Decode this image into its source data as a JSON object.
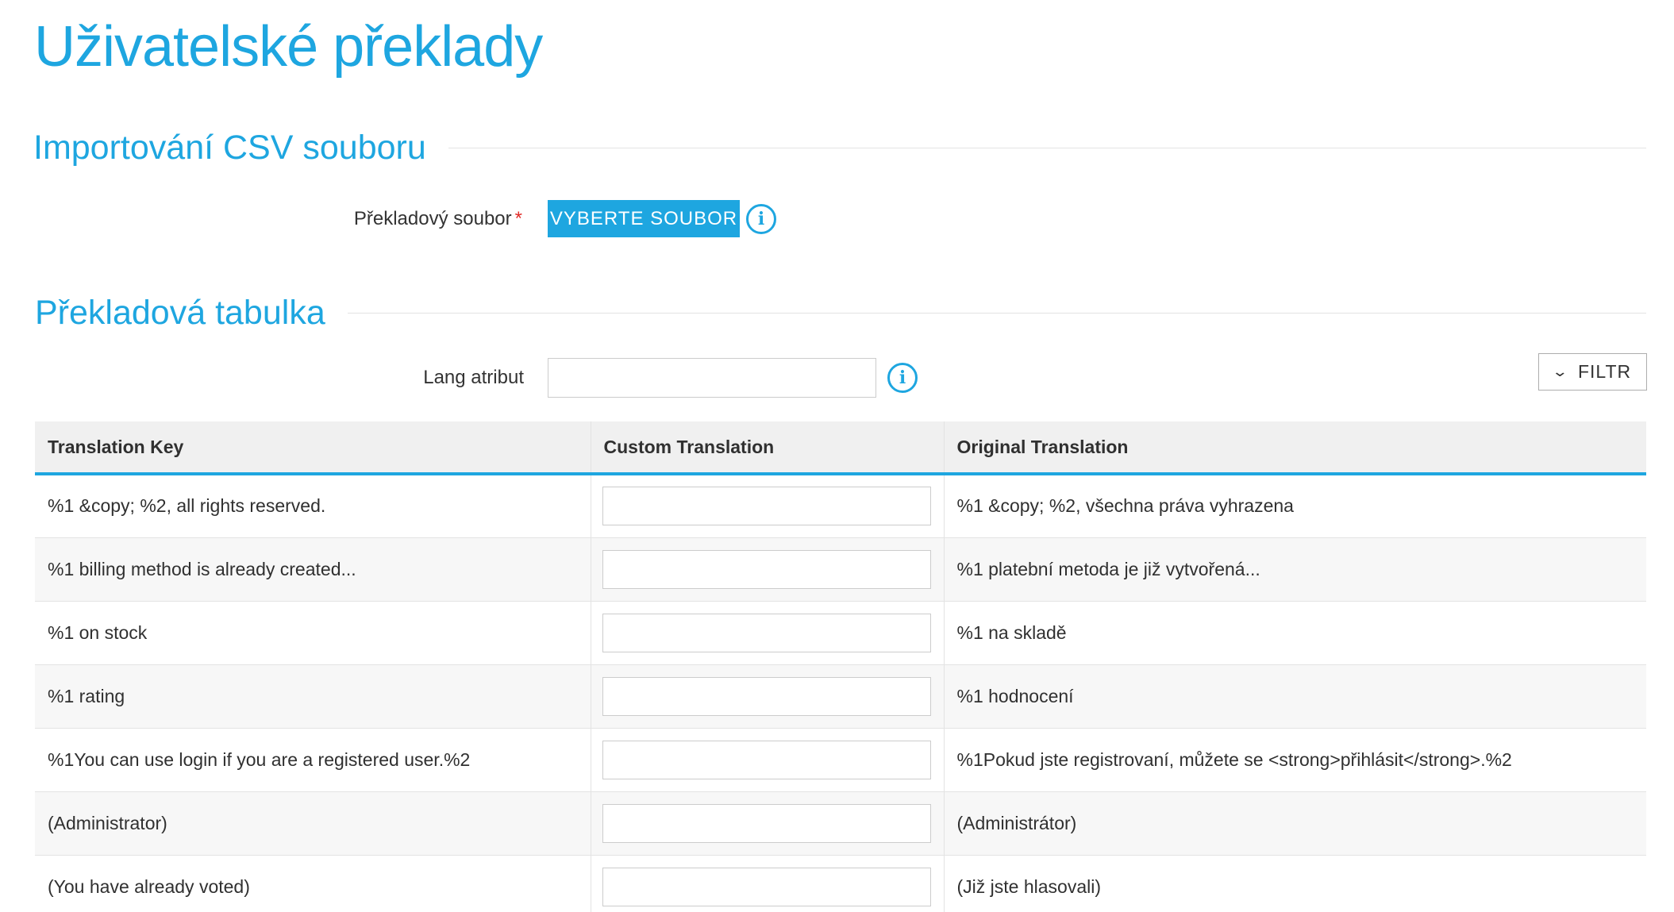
{
  "page": {
    "title": "Uživatelské překlady",
    "accent_color": "#1ea6e0"
  },
  "import_section": {
    "heading": "Importování CSV souboru",
    "file_label": "Překladový soubor",
    "required_mark": "*",
    "file_button": "VYBERTE SOUBOR",
    "info_icon": "i"
  },
  "table_section": {
    "heading": "Překladová tabulka",
    "lang_label": "Lang atribut",
    "lang_value": "",
    "info_icon": "i",
    "filter_label": "FILTR",
    "filter_icon": "⌄"
  },
  "table": {
    "columns": [
      "Translation Key",
      "Custom Translation",
      "Original Translation"
    ],
    "rows": [
      {
        "key": "%1 &copy; %2, all rights reserved.",
        "custom": "",
        "original": "%1 &copy; %2, všechna práva vyhrazena"
      },
      {
        "key": "%1 billing method is already created...",
        "custom": "",
        "original": "%1 platební metoda je již vytvořená..."
      },
      {
        "key": "%1 on stock",
        "custom": "",
        "original": "%1 na skladě"
      },
      {
        "key": "%1 rating",
        "custom": "",
        "original": "%1 hodnocení"
      },
      {
        "key": "%1You can use login if you are a registered user.%2",
        "custom": "",
        "original": "%1Pokud jste registrovaní, můžete se <strong>přihlásit</strong>.%2"
      },
      {
        "key": "(Administrator)",
        "custom": "",
        "original": "(Administrátor)"
      },
      {
        "key": "(You have already voted)",
        "custom": "",
        "original": "(Již jste hlasovali)"
      }
    ]
  }
}
